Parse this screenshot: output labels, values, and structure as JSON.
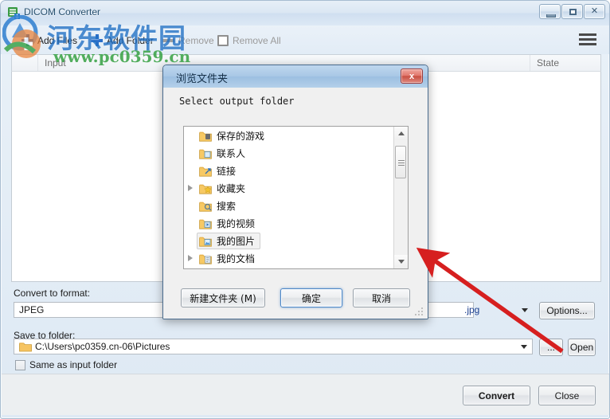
{
  "window": {
    "title": "DICOM Converter",
    "controls": {
      "minimize": "–",
      "maximize": "□",
      "close": "✕"
    }
  },
  "toolbar": {
    "add_files": "Add Files",
    "add_folder": "Add Folder",
    "remove": "Remove",
    "remove_all": "Remove All",
    "menu": "☰"
  },
  "file_list": {
    "columns": [
      "Input",
      "State"
    ],
    "rows": []
  },
  "form": {
    "format_label": "Convert to format:",
    "format_value": "JPEG",
    "extension_value": ".jpg",
    "options_button": "Options...",
    "save_label": "Save to folder:",
    "save_value": "C:\\Users\\pc0359.cn-06\\Pictures",
    "browse_button": "...",
    "open_button": "Open",
    "same_as_input": "Same as input folder"
  },
  "actions": {
    "convert": "Convert",
    "close": "Close"
  },
  "dialog": {
    "title": "浏览文件夹",
    "close_glyph": "x",
    "prompt": "Select output folder",
    "tree": [
      {
        "label": "保存的游戏",
        "expandable": false,
        "selected": false
      },
      {
        "label": "联系人",
        "expandable": false,
        "selected": false
      },
      {
        "label": "链接",
        "expandable": false,
        "selected": false
      },
      {
        "label": "收藏夹",
        "expandable": true,
        "selected": false
      },
      {
        "label": "搜索",
        "expandable": false,
        "selected": false
      },
      {
        "label": "我的视频",
        "expandable": false,
        "selected": false
      },
      {
        "label": "我的图片",
        "expandable": false,
        "selected": true
      },
      {
        "label": "我的文档",
        "expandable": true,
        "selected": false
      }
    ],
    "buttons": {
      "new_folder": "新建文件夹 (M)",
      "ok": "确定",
      "cancel": "取消"
    }
  },
  "watermark": {
    "text_cn": "河东软件园",
    "text_url": "www.pc0359.cn"
  },
  "colors": {
    "accent_blue": "#1f6fc4",
    "accent_green": "#2f9e3c",
    "annotation_red": "#d61f1f",
    "title_text": "#27506f",
    "ext_text": "#1c3f8f"
  }
}
